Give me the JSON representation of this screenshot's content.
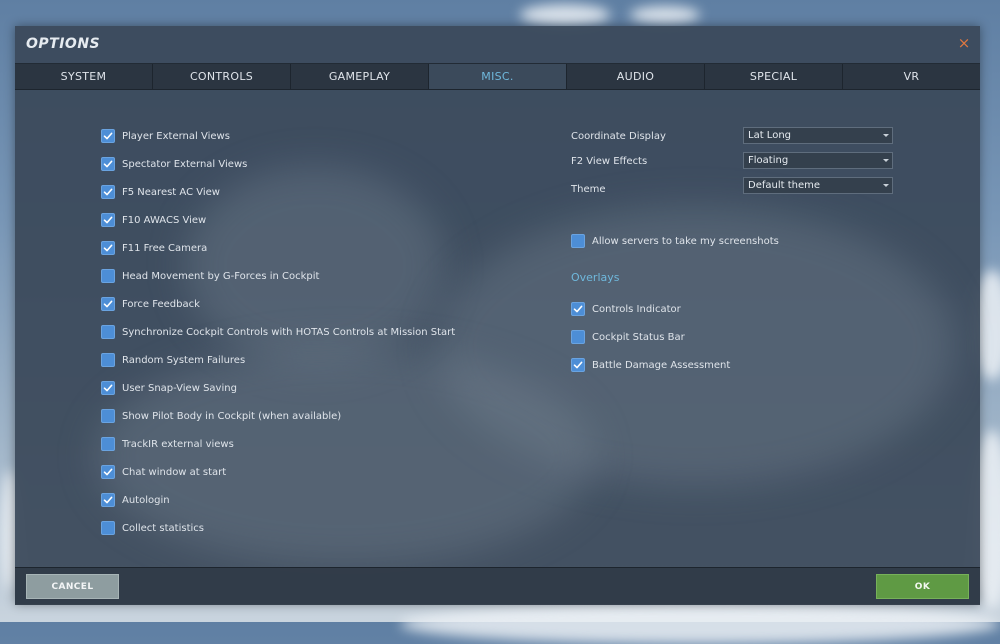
{
  "dialog": {
    "title": "OPTIONS",
    "close_icon": "×"
  },
  "tabs": [
    {
      "label": "SYSTEM"
    },
    {
      "label": "CONTROLS"
    },
    {
      "label": "GAMEPLAY"
    },
    {
      "label": "MISC."
    },
    {
      "label": "AUDIO"
    },
    {
      "label": "SPECIAL"
    },
    {
      "label": "VR"
    }
  ],
  "active_tab": "MISC.",
  "left_options": [
    {
      "label": "Player External Views",
      "checked": true
    },
    {
      "label": "Spectator External Views",
      "checked": true
    },
    {
      "label": "F5 Nearest AC View",
      "checked": true
    },
    {
      "label": "F10 AWACS View",
      "checked": true
    },
    {
      "label": "F11 Free Camera",
      "checked": true
    },
    {
      "label": "Head Movement by G-Forces in Cockpit",
      "checked": false
    },
    {
      "label": "Force Feedback",
      "checked": true
    },
    {
      "label": "Synchronize Cockpit Controls with HOTAS Controls at Mission Start",
      "checked": false
    },
    {
      "label": "Random System Failures",
      "checked": false
    },
    {
      "label": "User Snap-View Saving",
      "checked": true
    },
    {
      "label": "Show Pilot Body in Cockpit (when available)",
      "checked": false
    },
    {
      "label": "TrackIR external views",
      "checked": false
    },
    {
      "label": "Chat window at start",
      "checked": true
    },
    {
      "label": "Autologin",
      "checked": true
    },
    {
      "label": "Collect statistics",
      "checked": false
    }
  ],
  "settings": {
    "coordinate_display": {
      "label": "Coordinate Display",
      "value": "Lat Long"
    },
    "f2_view_effects": {
      "label": "F2 View Effects",
      "value": "Floating"
    },
    "theme": {
      "label": "Theme",
      "value": "Default theme"
    }
  },
  "screenshots_option": {
    "label": "Allow servers to take my screenshots",
    "checked": false
  },
  "overlays": {
    "title": "Overlays",
    "items": [
      {
        "label": "Controls Indicator",
        "checked": true
      },
      {
        "label": "Cockpit Status Bar",
        "checked": false
      },
      {
        "label": "Battle Damage Assessment",
        "checked": true
      }
    ]
  },
  "footer": {
    "cancel_label": "CANCEL",
    "ok_label": "OK"
  },
  "colors": {
    "accent": "#6fb8dc",
    "checkbox": "#4d8ed6",
    "ok_button": "#5f9a44",
    "cancel_button": "#8e9da0",
    "close": "#e07840"
  }
}
